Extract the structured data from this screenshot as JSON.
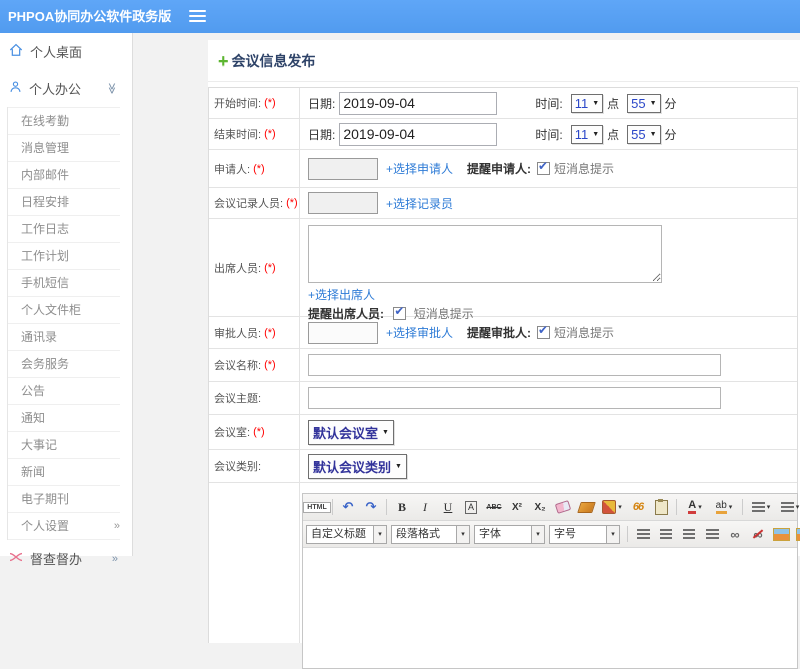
{
  "colors": {
    "topbar_blue": "#55a0f0",
    "link_blue": "#2e7bd6",
    "required_red": "#ff0000",
    "title_navy": "#2e4368",
    "select_text": "#32339b",
    "accent_green": "#5cb531"
  },
  "icons": {
    "select_arrow": "▼",
    "small_arrow": "▾",
    "check": "✔",
    "chevron_expanded": "≫",
    "chevron_collapsed": "»",
    "plus": "+",
    "undo": "↶",
    "redo": "↷",
    "infinity": "∞"
  },
  "topbar": {
    "title": "PHPOA协同办公软件政务版"
  },
  "sidebar": {
    "desktop_label": "个人桌面",
    "office_label": "个人办公",
    "sub_items": [
      "在线考勤",
      "消息管理",
      "内部邮件",
      "日程安排",
      "工作日志",
      "工作计划",
      "手机短信",
      "个人文件柜",
      "通讯录",
      "会务服务",
      "公告",
      "通知",
      "大事记",
      "新闻",
      "电子期刊"
    ],
    "settings_label": "个人设置",
    "supervision_label": "督查督办"
  },
  "main": {
    "title": "会议信息发布",
    "form": {
      "required_mark": "(*)",
      "start_time": {
        "label": "开始时间:",
        "date_label": "日期:",
        "date_value": "2019-09-04",
        "time_label": "时间:",
        "hour": "11",
        "hour_suffix": "点",
        "minute": "55",
        "minute_suffix": "分"
      },
      "end_time": {
        "label": "结束时间:",
        "date_label": "日期:",
        "date_value": "2019-09-04",
        "time_label": "时间:",
        "hour": "11",
        "hour_suffix": "点",
        "minute": "55",
        "minute_suffix": "分"
      },
      "applicant": {
        "label": "申请人:",
        "link": "+选择申请人",
        "remind_label": "提醒申请人:",
        "checkbox_label": "短消息提示"
      },
      "recorder": {
        "label": "会议记录人员:",
        "link": "+选择记录员"
      },
      "attendees": {
        "label": "出席人员:",
        "link": "+选择出席人",
        "remind_label": "提醒出席人员:",
        "checkbox_label": "短消息提示"
      },
      "approver": {
        "label": "审批人员:",
        "link": "+选择审批人",
        "remind_label": "提醒审批人:",
        "checkbox_label": "短消息提示"
      },
      "meeting_name": {
        "label": "会议名称:"
      },
      "meeting_topic": {
        "label": "会议主题:"
      },
      "meeting_room": {
        "label": "会议室:",
        "value": "默认会议室"
      },
      "meeting_type": {
        "label": "会议类别:",
        "value": "默认会议类别"
      }
    }
  },
  "editor": {
    "glyphs": {
      "html": "HTML",
      "bold": "B",
      "italic": "I",
      "underline": "U",
      "boxed_a": "A",
      "strike": "ABC",
      "sup": "X²",
      "sub": "X₂",
      "quote": "66",
      "font_color": "A",
      "highlight": "ab"
    },
    "dropdowns": {
      "heading": "自定义标题",
      "paragraph": "段落格式",
      "font": "字体",
      "size": "字号"
    }
  }
}
